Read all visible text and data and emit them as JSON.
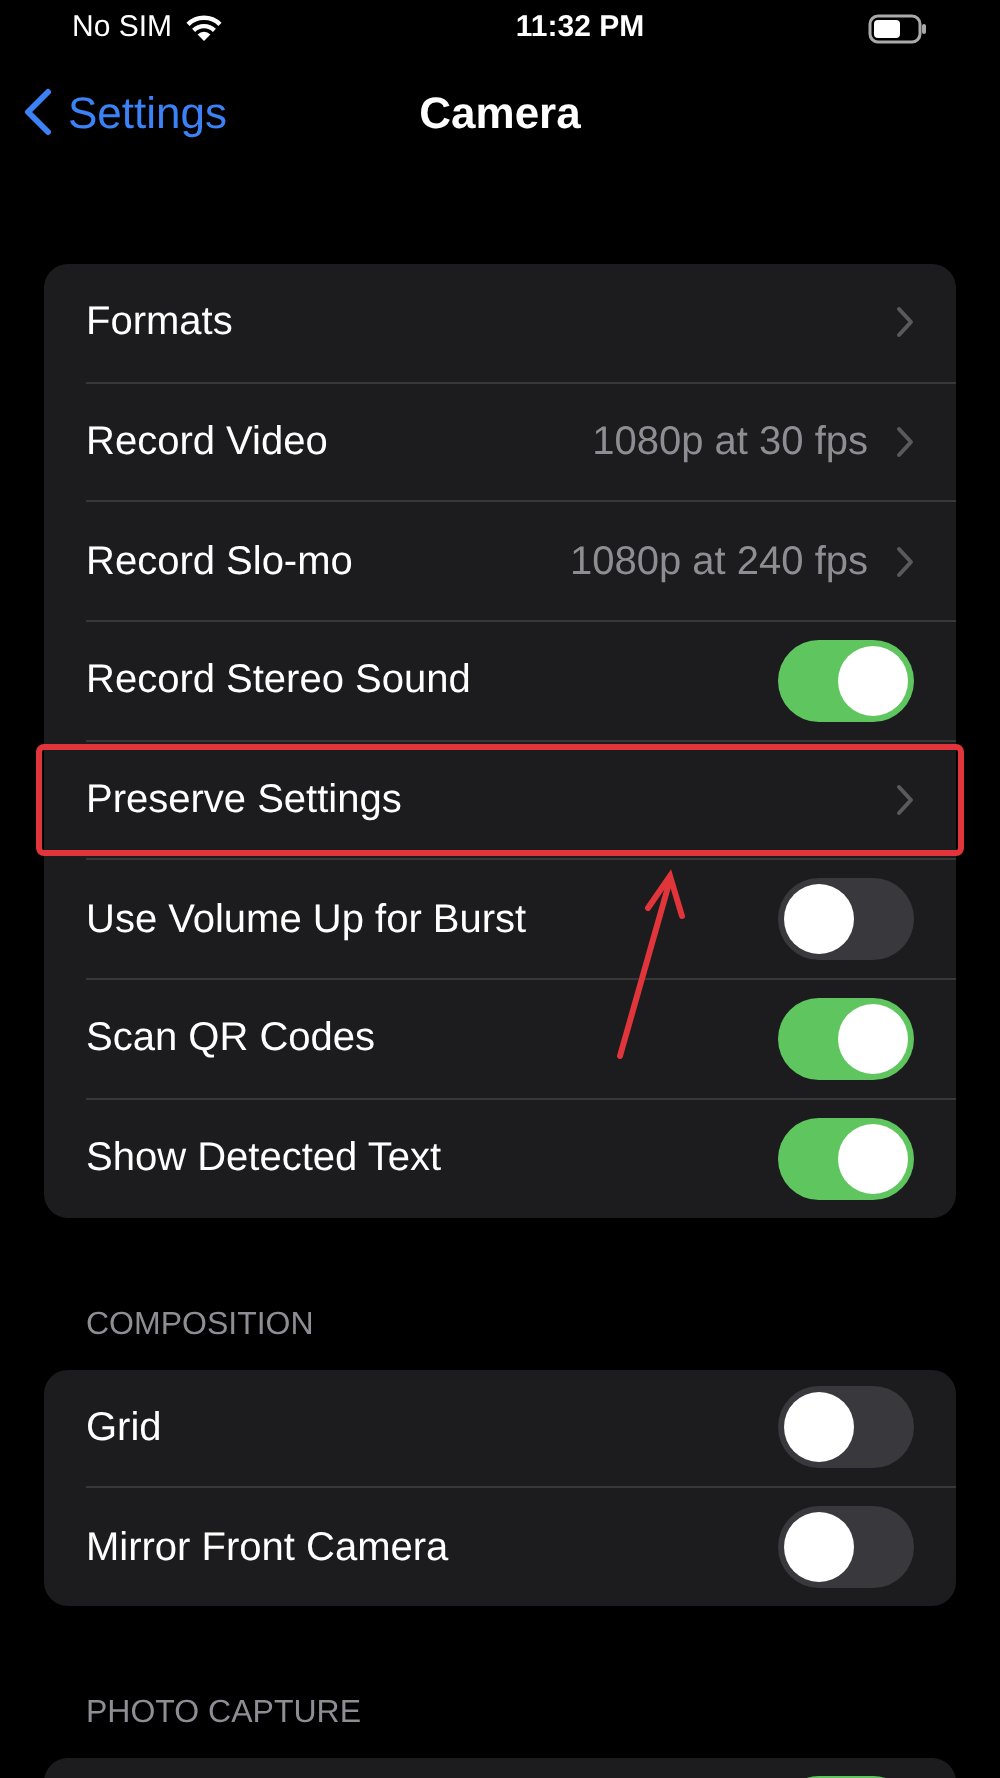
{
  "status_bar": {
    "carrier": "No SIM",
    "time": "11:32 PM"
  },
  "nav": {
    "back": "Settings",
    "title": "Camera"
  },
  "groups": [
    {
      "rows": [
        {
          "kind": "link",
          "label": "Formats",
          "highlighted": false
        },
        {
          "kind": "link",
          "label": "Record Video",
          "value": "1080p at 30 fps",
          "highlighted": false
        },
        {
          "kind": "link",
          "label": "Record Slo-mo",
          "value": "1080p at 240 fps",
          "highlighted": false
        },
        {
          "kind": "toggle",
          "label": "Record Stereo Sound",
          "on": true,
          "highlighted": false
        },
        {
          "kind": "link",
          "label": "Preserve Settings",
          "highlighted": true
        },
        {
          "kind": "toggle",
          "label": "Use Volume Up for Burst",
          "on": false,
          "highlighted": false
        },
        {
          "kind": "toggle",
          "label": "Scan QR Codes",
          "on": true,
          "highlighted": false
        },
        {
          "kind": "toggle",
          "label": "Show Detected Text",
          "on": true,
          "highlighted": false
        }
      ]
    },
    {
      "header": "COMPOSITION",
      "rows": [
        {
          "kind": "toggle",
          "label": "Grid",
          "on": false,
          "highlighted": false
        },
        {
          "kind": "toggle",
          "label": "Mirror Front Camera",
          "on": false,
          "highlighted": false
        }
      ]
    },
    {
      "header": "PHOTO CAPTURE",
      "rows": [
        {
          "kind": "toggle",
          "on": true,
          "highlighted": false
        }
      ]
    }
  ]
}
